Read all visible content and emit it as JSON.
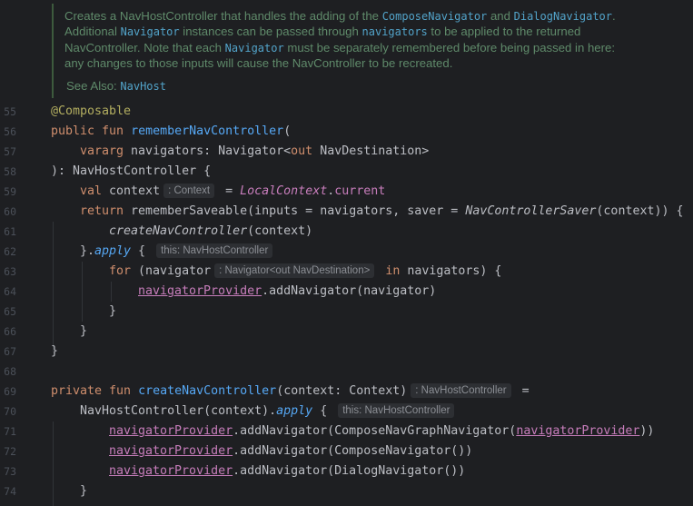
{
  "doc": {
    "line1_a": "Creates a NavHostController that handles the adding of the ",
    "line1_code1": "ComposeNavigator",
    "line1_b": " and ",
    "line1_code2": "DialogNavigator",
    "line1_c": ".",
    "line2_a": "Additional ",
    "line2_code1": "Navigator",
    "line2_b": " instances can be passed through ",
    "line2_code2": "navigators",
    "line2_c": " to be applied to the returned",
    "line3_a": "NavController. Note that each ",
    "line3_code1": "Navigator",
    "line3_b": " must be separately remembered before being passed in here:",
    "line4": "any changes to those inputs will cause the NavController to be recreated.",
    "see_also_label": "See Also: ",
    "see_also_link": "NavHost"
  },
  "line_numbers": [
    "55",
    "56",
    "57",
    "58",
    "59",
    "60",
    "61",
    "62",
    "63",
    "64",
    "65",
    "66",
    "67",
    "68",
    "69",
    "70",
    "71",
    "72",
    "73",
    "74"
  ],
  "code": {
    "l55": {
      "ann": "@Composable"
    },
    "l56": {
      "kw": "public fun ",
      "fn": "rememberNavController",
      "rest": "("
    },
    "l57": {
      "kw": "vararg ",
      "rest1": "navigators: Navigator<",
      "kw2": "out",
      "rest2": " NavDestination>"
    },
    "l58": {
      "text": "): NavHostController {"
    },
    "l59": {
      "kw": "val ",
      "name": "context",
      "hint": ": Context",
      "eq": " = ",
      "prop": "LocalContext",
      "rest": ".",
      "prop2": "current"
    },
    "l60": {
      "kw": "return ",
      "fn": "rememberSaveable",
      "a": "(inputs = navigators, saver = ",
      "it": "NavControllerSaver",
      "b": "(context)) {"
    },
    "l61": {
      "it": "createNavController",
      "rest": "(context)"
    },
    "l62": {
      "a": "}.",
      "it": "apply",
      "b": " { ",
      "hint": "this: NavHostController"
    },
    "l63": {
      "kw": "for ",
      "a": "(navigator",
      "hint": ": Navigator<out NavDestination>",
      "kw2": " in ",
      "b": "navigators) {"
    },
    "l64": {
      "prop": "navigatorProvider",
      "rest": ".addNavigator(navigator)"
    },
    "l65": {
      "text": "}"
    },
    "l66": {
      "text": "}"
    },
    "l67": {
      "text": "}"
    },
    "l68": {
      "text": ""
    },
    "l69": {
      "kw": "private fun ",
      "fn": "createNavController",
      "a": "(context: Context)",
      "hint": ": NavHostController",
      "b": " ="
    },
    "l70": {
      "a": "NavHostController(context).",
      "it": "apply",
      "b": " { ",
      "hint": "this: NavHostController"
    },
    "l71": {
      "prop": "navigatorProvider",
      "a": ".addNavigator(ComposeNavGraphNavigator(",
      "prop2": "navigatorProvider",
      "b": "))"
    },
    "l72": {
      "prop": "navigatorProvider",
      "a": ".addNavigator(ComposeNavigator())"
    },
    "l73": {
      "prop": "navigatorProvider",
      "a": ".addNavigator(DialogNavigator())"
    },
    "l74": {
      "text": "}"
    }
  },
  "colors": {
    "background": "#1e1f22",
    "keyword": "#cf8e6d",
    "function": "#56a8f5",
    "annotation": "#b3ae60",
    "property": "#c77dbb",
    "doc_text": "#5f8a6a"
  }
}
